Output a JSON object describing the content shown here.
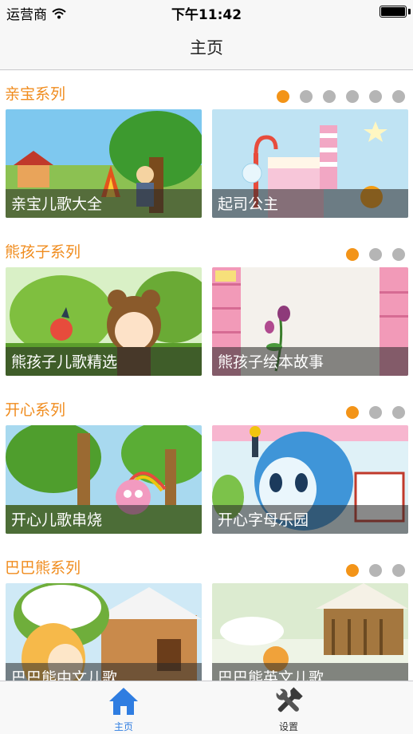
{
  "status_bar": {
    "carrier": "运营商",
    "time": "下午11:42"
  },
  "nav": {
    "title": "主页"
  },
  "sections": [
    {
      "title": "亲宝系列",
      "page_count": 6,
      "current_page": 1,
      "items": [
        {
          "label": "亲宝儿歌大全"
        },
        {
          "label": "起司公主"
        }
      ]
    },
    {
      "title": "熊孩子系列",
      "page_count": 3,
      "current_page": 1,
      "items": [
        {
          "label": "熊孩子儿歌精选"
        },
        {
          "label": "熊孩子绘本故事"
        }
      ]
    },
    {
      "title": "开心系列",
      "page_count": 3,
      "current_page": 1,
      "items": [
        {
          "label": "开心儿歌串烧"
        },
        {
          "label": "开心字母乐园"
        }
      ]
    },
    {
      "title": "巴巴熊系列",
      "page_count": 3,
      "current_page": 1,
      "items": [
        {
          "label": "巴巴熊中文儿歌"
        },
        {
          "label": "巴巴熊英文儿歌"
        }
      ]
    }
  ],
  "tab_bar": {
    "tabs": [
      {
        "label": "主页",
        "icon": "home-icon",
        "selected": true
      },
      {
        "label": "设置",
        "icon": "tools-icon",
        "selected": false
      }
    ]
  },
  "colors": {
    "accent": "#f08c1e",
    "dot_active": "#f39418",
    "dot_inactive": "#b5b5b5",
    "tab_selected": "#2f7de1"
  }
}
